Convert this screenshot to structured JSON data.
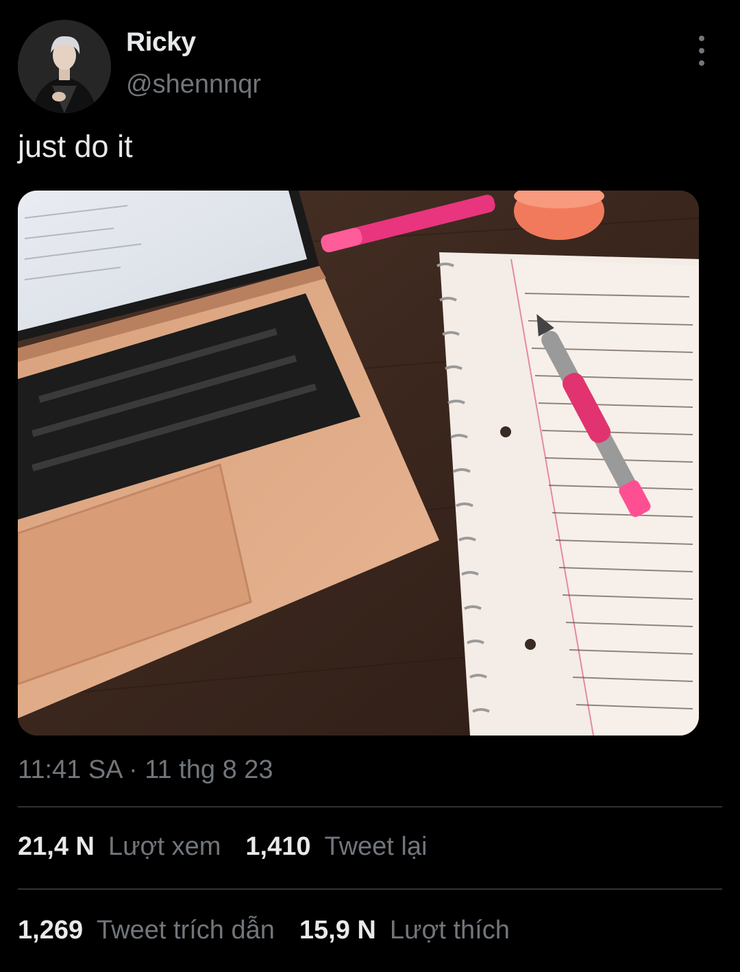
{
  "tweet": {
    "author": {
      "display_name": "Ricky",
      "handle": "@shennnqr",
      "avatar_icon": "profile-photo"
    },
    "text": "just do it",
    "media": {
      "description_icon": "photo-laptop-notebook-pen"
    },
    "timestamp": "11:41 SA · 11 thg 8 23",
    "more_icon": "more-vertical-icon"
  },
  "stats": {
    "row1": [
      {
        "value": "21,4 N",
        "label": "Lượt xem"
      },
      {
        "value": "1,410",
        "label": "Tweet lại"
      }
    ],
    "row2": [
      {
        "value": "1,269",
        "label": "Tweet trích dẫn"
      },
      {
        "value": "15,9 N",
        "label": "Lượt thích"
      }
    ]
  },
  "colors": {
    "background": "#000000",
    "primary_text": "#e7e9ea",
    "secondary_text": "#71767b",
    "divider": "#2f3336"
  }
}
